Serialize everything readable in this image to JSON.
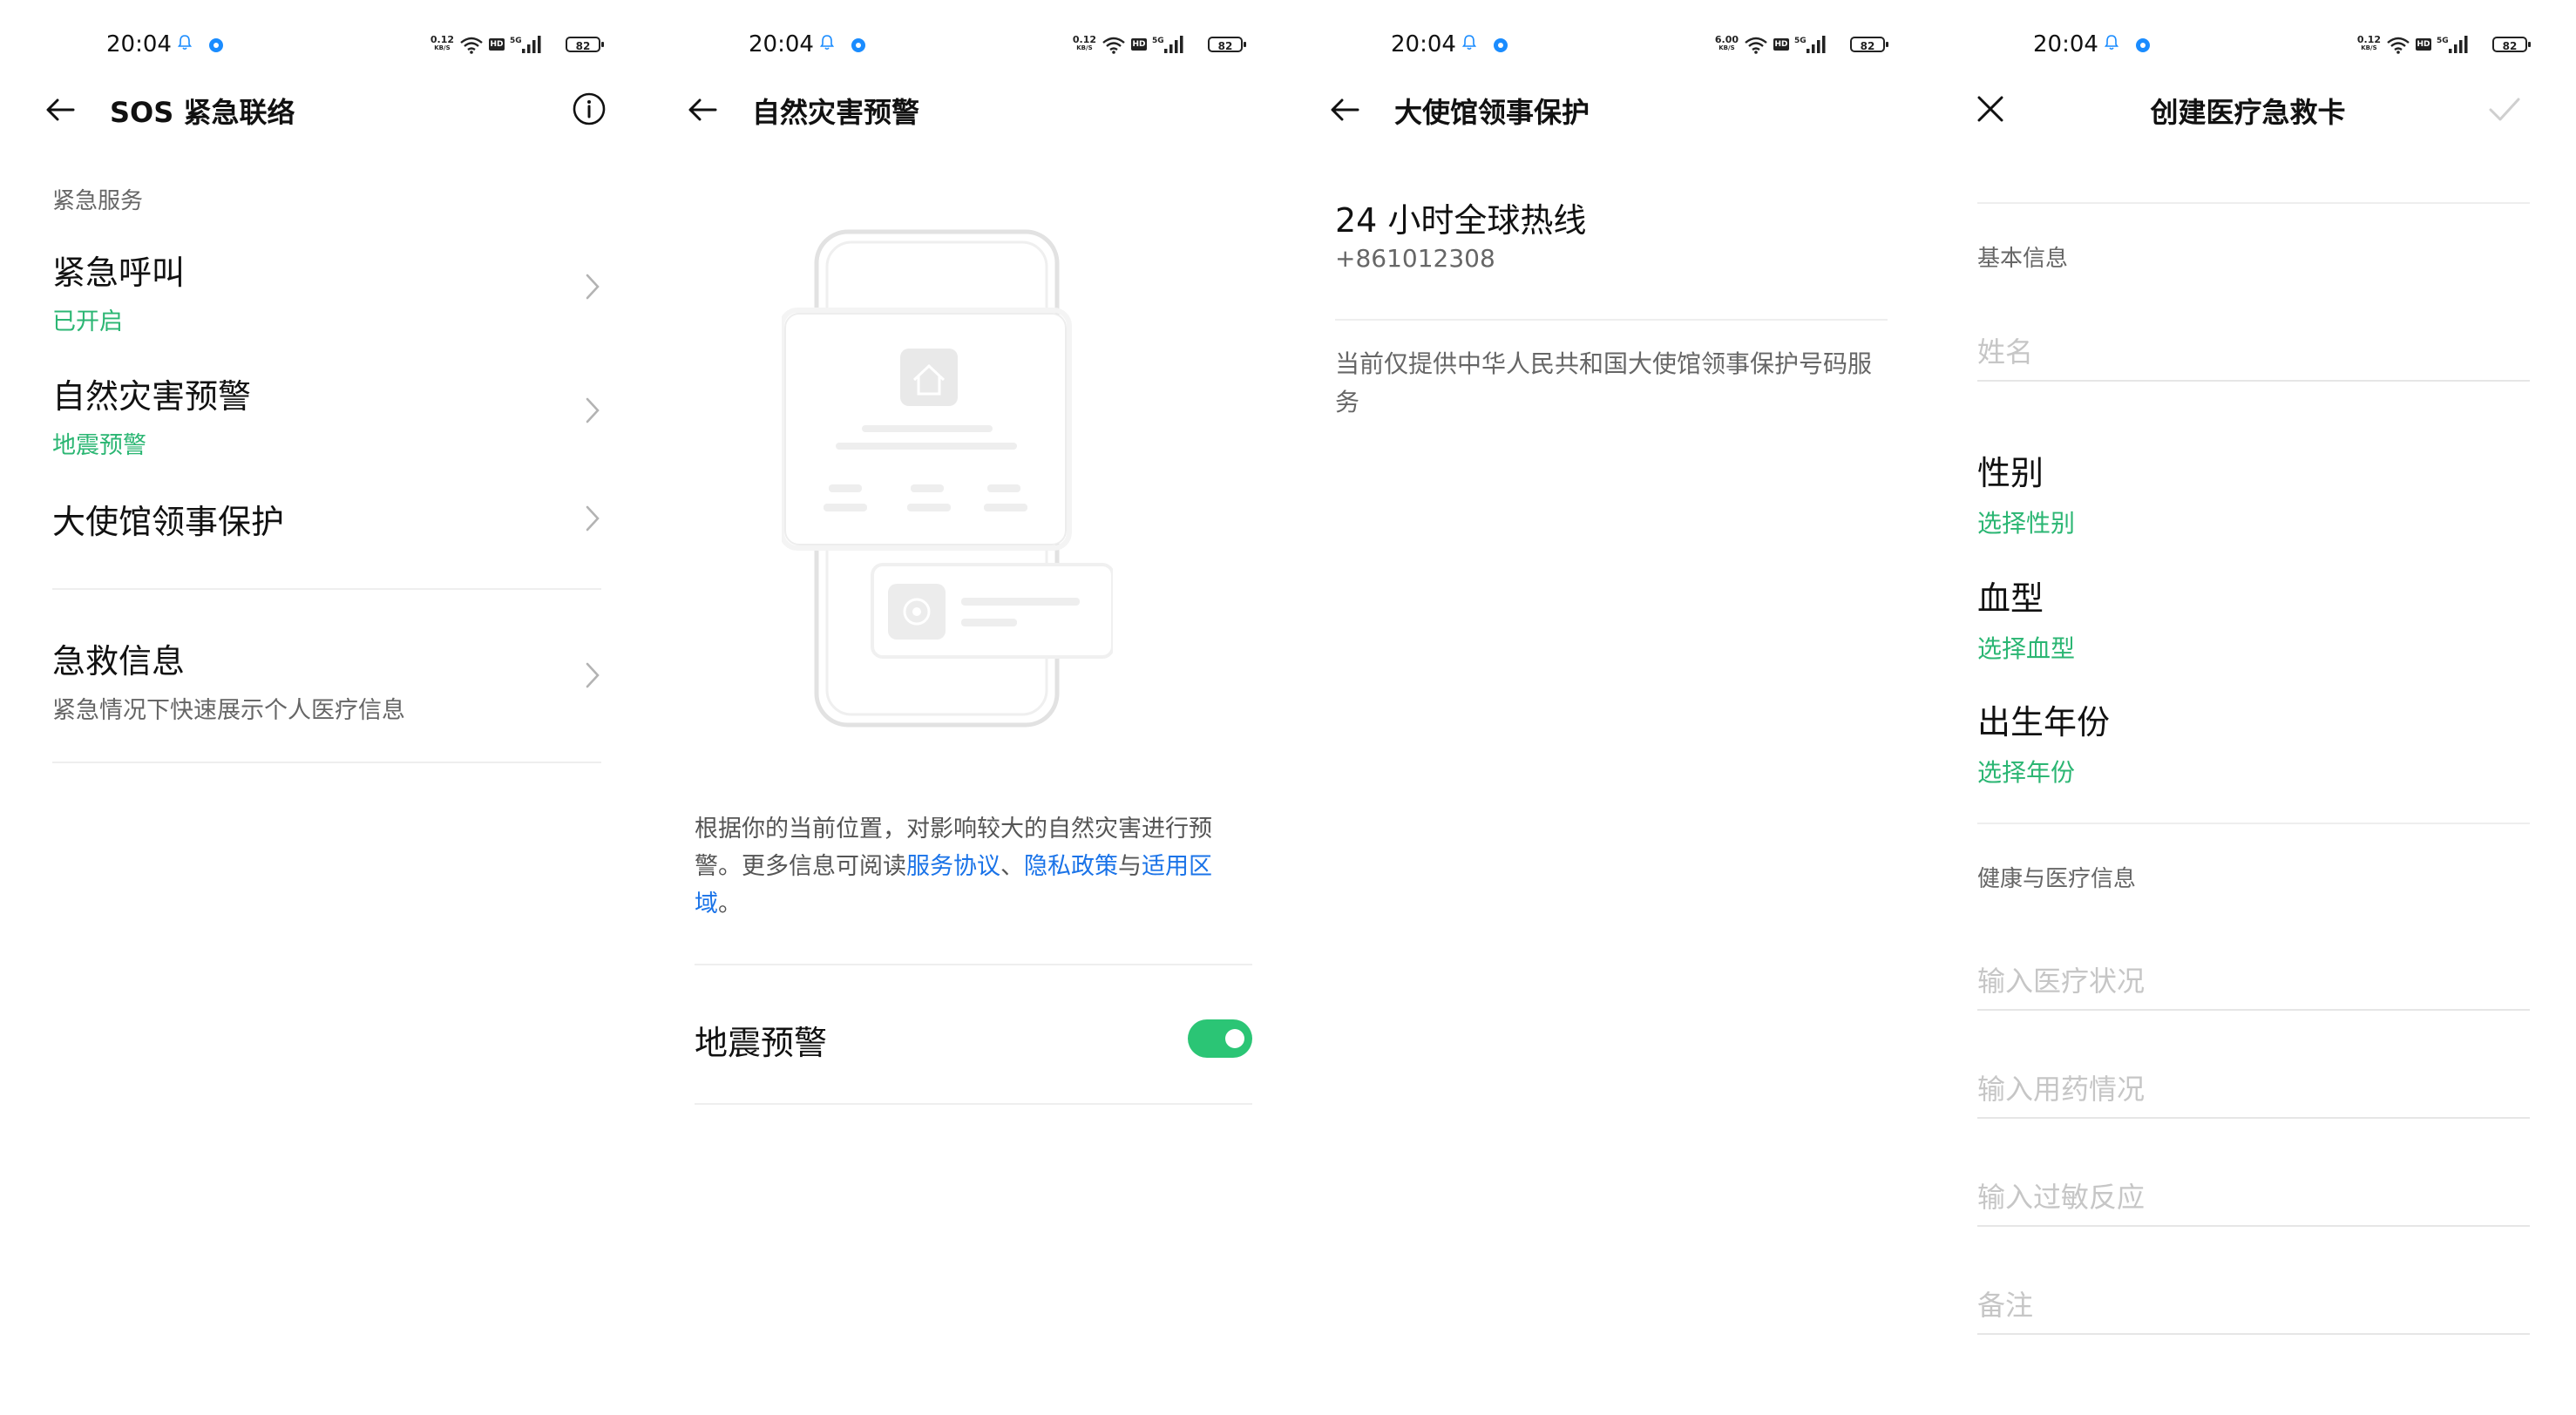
{
  "status_bar": {
    "time": "20:04",
    "speed_a": {
      "value": "0.12",
      "unit": "KB/S"
    },
    "speed_b": {
      "value": "6.00",
      "unit": "KB/S"
    },
    "hd": "HD",
    "network": "5G",
    "battery": "82"
  },
  "screen1": {
    "title": "SOS 紧急联络",
    "section_header": "紧急服务",
    "items": [
      {
        "title": "紧急呼叫",
        "sub": "已开启"
      },
      {
        "title": "自然灾害预警",
        "sub": "地震预警"
      },
      {
        "title": "大使馆领事保护",
        "sub": ""
      },
      {
        "title": "急救信息",
        "sub": "紧急情况下快速展示个人医疗信息"
      }
    ]
  },
  "screen2": {
    "title": "自然灾害预警",
    "desc_prefix": "根据你的当前位置，对影响较大的自然灾害进行预警。更多信息可阅读",
    "link_terms": "服务协议",
    "sep1": "、",
    "link_privacy": "隐私政策",
    "sep2": "与",
    "link_region": "适用区域",
    "desc_suffix": "。",
    "toggle_label": "地震预警",
    "toggle_on": true
  },
  "screen3": {
    "title": "大使馆领事保护",
    "hotline_title": "24 小时全球热线",
    "hotline_number": "+861012308",
    "note": "当前仅提供中华人民共和国大使馆领事保护号码服务"
  },
  "screen4": {
    "title": "创建医疗急救卡",
    "basic_header": "基本信息",
    "name_placeholder": "姓名",
    "pickers": [
      {
        "title": "性别",
        "sub": "选择性别"
      },
      {
        "title": "血型",
        "sub": "选择血型"
      },
      {
        "title": "出生年份",
        "sub": "选择年份"
      }
    ],
    "health_header": "健康与医疗信息",
    "medical_placeholder": "输入医疗状况",
    "medication_placeholder": "输入用药情况",
    "allergy_placeholder": "输入过敏反应",
    "notes_placeholder": "备注"
  },
  "colors": {
    "accent_green": "#2bb673",
    "toggle_green": "#2bc575",
    "link_blue": "#1a73e8",
    "location_dot": "#1a8cff"
  },
  "icons": [
    "back-arrow-icon",
    "info-icon",
    "chevron-right-icon",
    "close-icon",
    "check-icon",
    "bell-icon",
    "wifi-icon",
    "signal-icon",
    "battery-icon",
    "home-icon",
    "alarm-icon"
  ]
}
